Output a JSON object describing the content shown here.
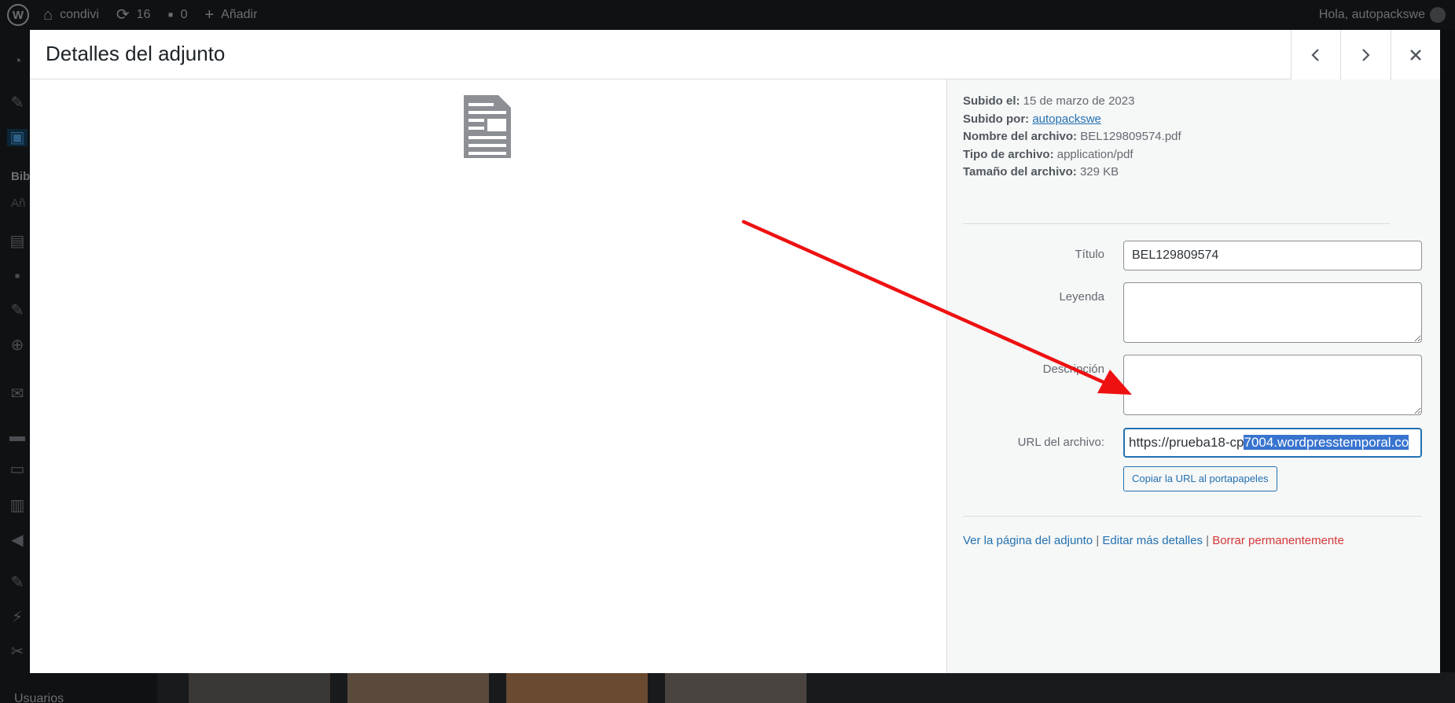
{
  "adminbar": {
    "site_name": "condivi",
    "updates_count": "16",
    "comments_count": "0",
    "add_label": "Añadir",
    "greeting": "Hola, autopackswe"
  },
  "sidebar": {
    "fragment_bold": "Bib",
    "fragment_light": "Añ",
    "users_label": "Usuarios"
  },
  "modal": {
    "title": "Detalles del adjunto",
    "prev_icon": "chevron-left-icon",
    "next_icon": "chevron-right-icon",
    "close_icon": "close-icon"
  },
  "attachment": {
    "file_icon": "document-icon",
    "uploaded_on_label": "Subido el:",
    "uploaded_on": "15 de marzo de 2023",
    "uploaded_by_label": "Subido por:",
    "uploaded_by": "autopackswe",
    "filename_label": "Nombre del archivo:",
    "filename": "BEL129809574.pdf",
    "filetype_label": "Tipo de archivo:",
    "filetype": "application/pdf",
    "filesize_label": "Tamaño del archivo:",
    "filesize": "329 KB"
  },
  "fields": {
    "title_label": "Título",
    "title_value": "BEL129809574",
    "caption_label": "Leyenda",
    "caption_value": "",
    "description_label": "Descripción",
    "description_value": "",
    "url_label": "URL del archivo:",
    "url_unselected": "https://prueba18-cp",
    "url_selected": "7004.wordpresstemporal.co",
    "copy_button": "Copiar la URL al portapapeles"
  },
  "actions": {
    "view_page": "Ver la página del adjunto",
    "edit_more": "Editar más detalles",
    "delete": "Borrar permanentemente",
    "separator": "|"
  },
  "colors": {
    "accent": "#2271b1",
    "danger": "#d63638",
    "annotation_arrow": "#ee1111",
    "selection": "#3874cf"
  }
}
